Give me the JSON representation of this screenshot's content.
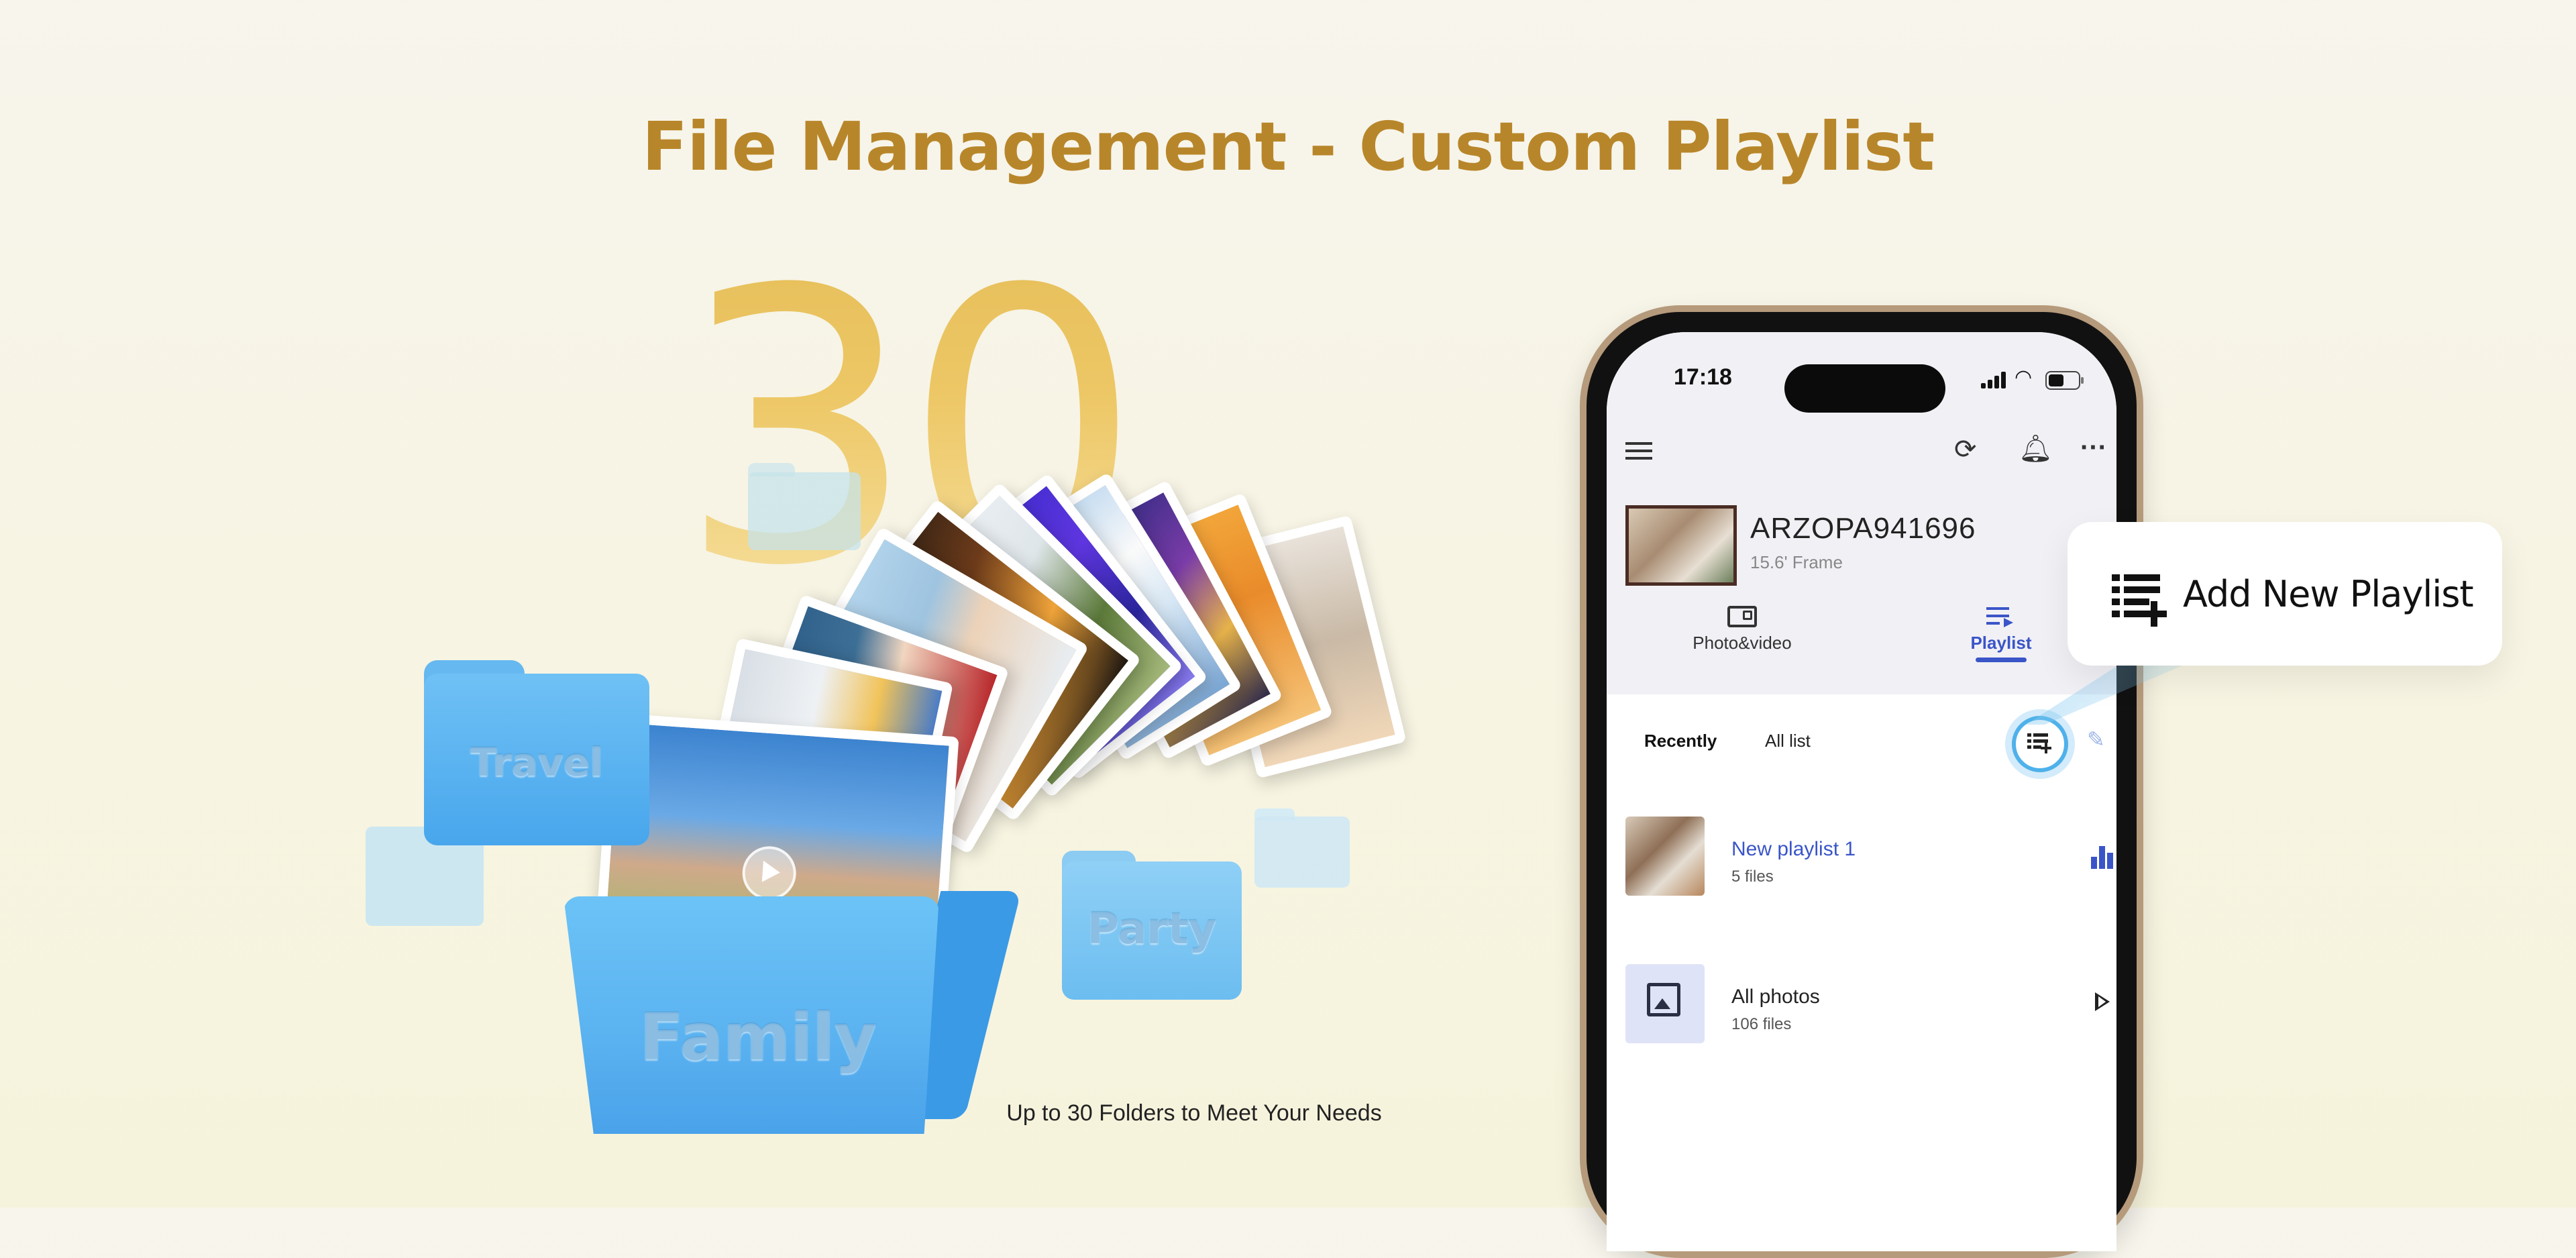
{
  "heading": {
    "title": "File Management - Custom Playlist",
    "color": "#b8862a"
  },
  "hero": {
    "number": "30",
    "folders": [
      "Travel",
      "Family",
      "Party"
    ],
    "caption": "Up to 30 Folders to Meet Your Needs"
  },
  "phone": {
    "status": {
      "time": "17:18"
    },
    "toolbar": {
      "menu_icon": "hamburger-icon",
      "sync_icon": "sync-icon",
      "bell_icon": "bell-icon",
      "more_icon": "more-icon"
    },
    "device": {
      "name": "ARZOPA941696",
      "subtitle": "15.6' Frame"
    },
    "tabs": [
      {
        "label": "Photo&video",
        "active": false
      },
      {
        "label": "Playlist",
        "active": true
      }
    ],
    "filters": [
      {
        "label": "Recently",
        "active": true
      },
      {
        "label": "All list",
        "active": false
      }
    ],
    "playlists": [
      {
        "name": "New playlist 1",
        "files": "5 files",
        "name_color": "#3a55c8",
        "action_icon": "equalizer-icon"
      },
      {
        "name": "All photos",
        "files": "106 files",
        "name_color": "#222222",
        "action_icon": "play-icon"
      }
    ],
    "accent": "#3a55c8"
  },
  "callout": {
    "label": "Add New Playlist"
  }
}
